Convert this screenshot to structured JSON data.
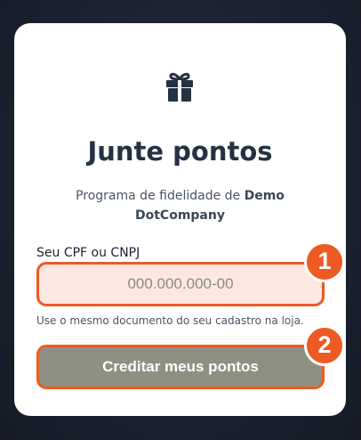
{
  "card": {
    "icon": "gift-icon",
    "title": "Junte pontos",
    "subtitle_prefix": "Programa de fidelidade de ",
    "store_name": "Demo DotCompany"
  },
  "form": {
    "document_label": "Seu CPF ou CNPJ",
    "document_placeholder": "000.000.000-00",
    "document_value": "",
    "hint": "Use o mesmo documento do seu cadastro na loja.",
    "submit_label": "Creditar meus pontos"
  },
  "annotations": {
    "step_1": "1",
    "step_2": "2"
  },
  "colors": {
    "accent": "#ee5a24",
    "input_bg": "#fde8e1",
    "button_bg": "#8e9182",
    "title": "#243242",
    "page_bg": "#1b2130"
  }
}
